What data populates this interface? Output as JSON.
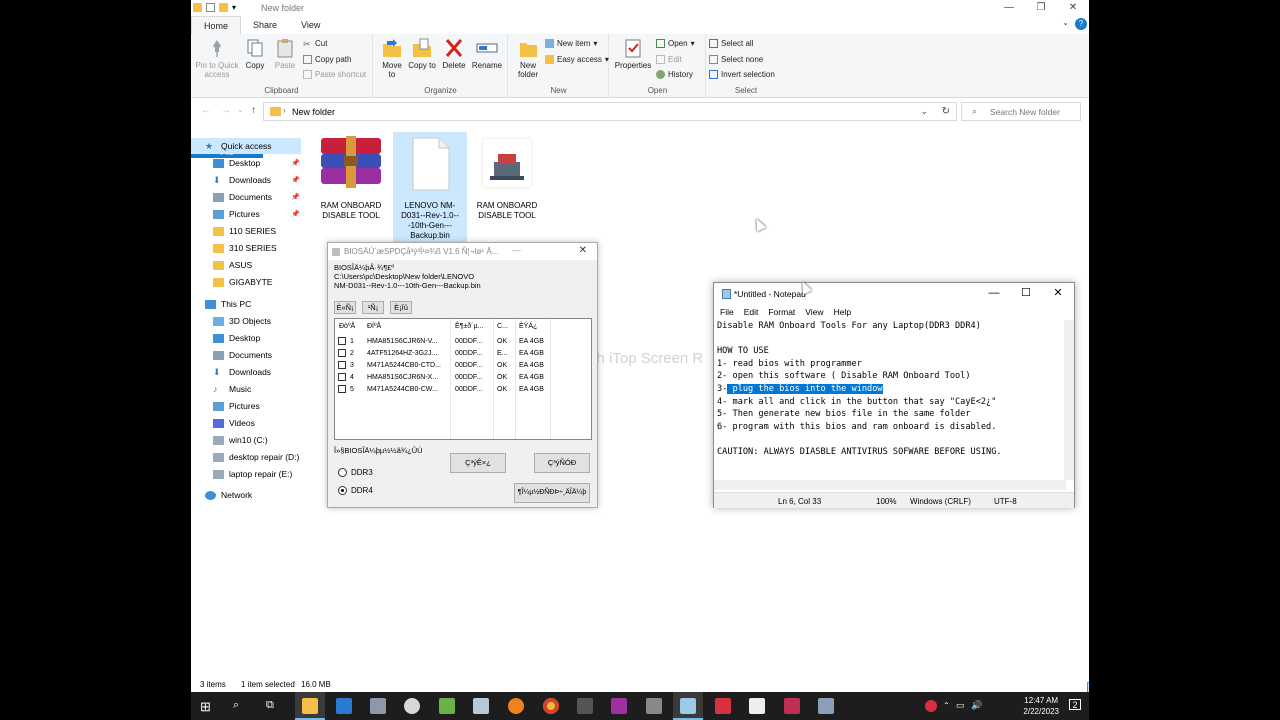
{
  "explorer": {
    "title": "New folder",
    "tabs": [
      "File",
      "Home",
      "Share",
      "View"
    ],
    "ribbon": {
      "clipboard": {
        "pin_label": "Pin to Quick access",
        "copy": "Copy",
        "paste": "Paste",
        "cut": "Cut",
        "copy_path": "Copy path",
        "paste_shortcut": "Paste shortcut",
        "group": "Clipboard"
      },
      "organize": {
        "move_to": "Move to",
        "copy_to": "Copy to",
        "delete": "Delete",
        "rename": "Rename",
        "group": "Organize"
      },
      "new": {
        "new_folder": "New folder",
        "new_item": "New item",
        "easy_access": "Easy access",
        "group": "New"
      },
      "open": {
        "properties": "Properties",
        "open": "Open",
        "edit": "Edit",
        "history": "History",
        "group": "Open"
      },
      "select": {
        "select_all": "Select all",
        "select_none": "Select none",
        "invert": "Invert selection",
        "group": "Select"
      }
    },
    "address": "New folder",
    "search_placeholder": "Search New folder",
    "nav": {
      "quick_access": "Quick access",
      "items": [
        "Desktop",
        "Downloads",
        "Documents",
        "Pictures",
        "110 SERIES",
        "310 SERIES",
        "ASUS",
        "GIGABYTE"
      ],
      "this_pc": "This PC",
      "pc_items": [
        "3D Objects",
        "Desktop",
        "Documents",
        "Downloads",
        "Music",
        "Pictures",
        "Videos",
        "win10 (C:)",
        "desktop repair (D:)",
        "laptop repair (E:)"
      ],
      "network": "Network"
    },
    "files": [
      {
        "name": "RAM ONBOARD DISABLE TOOL",
        "icon": "winrar-archive-icon"
      },
      {
        "name": "LENOVO NM-D031--Rev-1.0---10th-Gen---Backup.bin",
        "icon": "blank-file-icon",
        "selected": true
      },
      {
        "name": "RAM ONBOARD DISABLE TOOL",
        "icon": "app-icon"
      }
    ],
    "status": {
      "items": "3 items",
      "selected": "1 item selected",
      "size": "16.0 MB"
    }
  },
  "bios_dialog": {
    "title": "BIOSÄÚ´æSPDÇå³ý³Ì¹¤¾ß V1.6   Ñ¦¬Iø¹ Â...",
    "file_label": "BIOSÎÄ¼þÂ·¾¶£º",
    "file_path": "C:\\Users\\pc\\Desktop\\New folder\\LENOVO\nNM-D031--Rev-1.0---10th-Gen---Backup.bin",
    "toolbar": [
      "È«Ñ¡",
      "¹Ñ¡",
      "È¡Ïû"
    ],
    "columns": [
      "ÐòºÅ",
      "ÐÍºÅ",
      "Ê¶±ð´µ...",
      "C...",
      "ÈÝÁ¿"
    ],
    "rows": [
      {
        "n": "1",
        "model": "HMA851S6CJR6N-V...",
        "id": "00DDF...",
        "c": "OK",
        "cap": "EA 4GB"
      },
      {
        "n": "2",
        "model": "4ATF51264HZ-3G2J...",
        "id": "00DDF...",
        "c": "E...",
        "cap": "EA 4GB"
      },
      {
        "n": "3",
        "model": "M471A5244CB0-CTD...",
        "id": "00DDF...",
        "c": "OK",
        "cap": "EA 4GB"
      },
      {
        "n": "4",
        "model": "HMA851S6CJR6N-X...",
        "id": "00DDF...",
        "c": "OK",
        "cap": "EA 4GB"
      },
      {
        "n": "5",
        "model": "M471A5244CB0-CW...",
        "id": "00DDF...",
        "c": "OK",
        "cap": "EA 4GB"
      }
    ],
    "status": "Î»§BIOSÎÄ¼þµ½½â¾¿ÛÙ",
    "btn_a": "Ç³ýÊ×¿",
    "btn_b": "Ç³ýÑÓÐ",
    "btn_c": "¶Î¼µ½ÐÑÐÞ÷¸ÄÎÄ¼þ",
    "radio_ddr3": "DDR3",
    "radio_ddr4": "DDR4",
    "ddr4_selected": true
  },
  "notepad": {
    "title": "*Untitled - Notepad",
    "menu": [
      "File",
      "Edit",
      "Format",
      "View",
      "Help"
    ],
    "lines": [
      "Disable RAM Onboard Tools For any Laptop(DDR3 DDR4)",
      "",
      "HOW TO USE",
      "1- read bios with programmer",
      "2- open this software ( Disable RAM Onboard Tool)",
      "3- plug the bios into the window",
      "4- mark all and click in the button that say \"CayE<2¿\"",
      "5- Then generate new bios file in the same folder",
      "6- program with this bios and ram onboard is disabled.",
      "",
      "CAUTION: ALWAYS DIASBLE ANTIVIRUS SOFWARE BEFORE USING."
    ],
    "line3_prefix": "3-",
    "line3_selected": " plug the bios into the window",
    "status": {
      "position": "Ln 6, Col 33",
      "zoom": "100%",
      "eol": "Windows (CRLF)",
      "encoding": "UTF-8"
    }
  },
  "watermark": "ded with iTop Screen R",
  "taskbar": {
    "time": "12:47 AM",
    "date": "2/22/2023",
    "notification_count": "2"
  }
}
